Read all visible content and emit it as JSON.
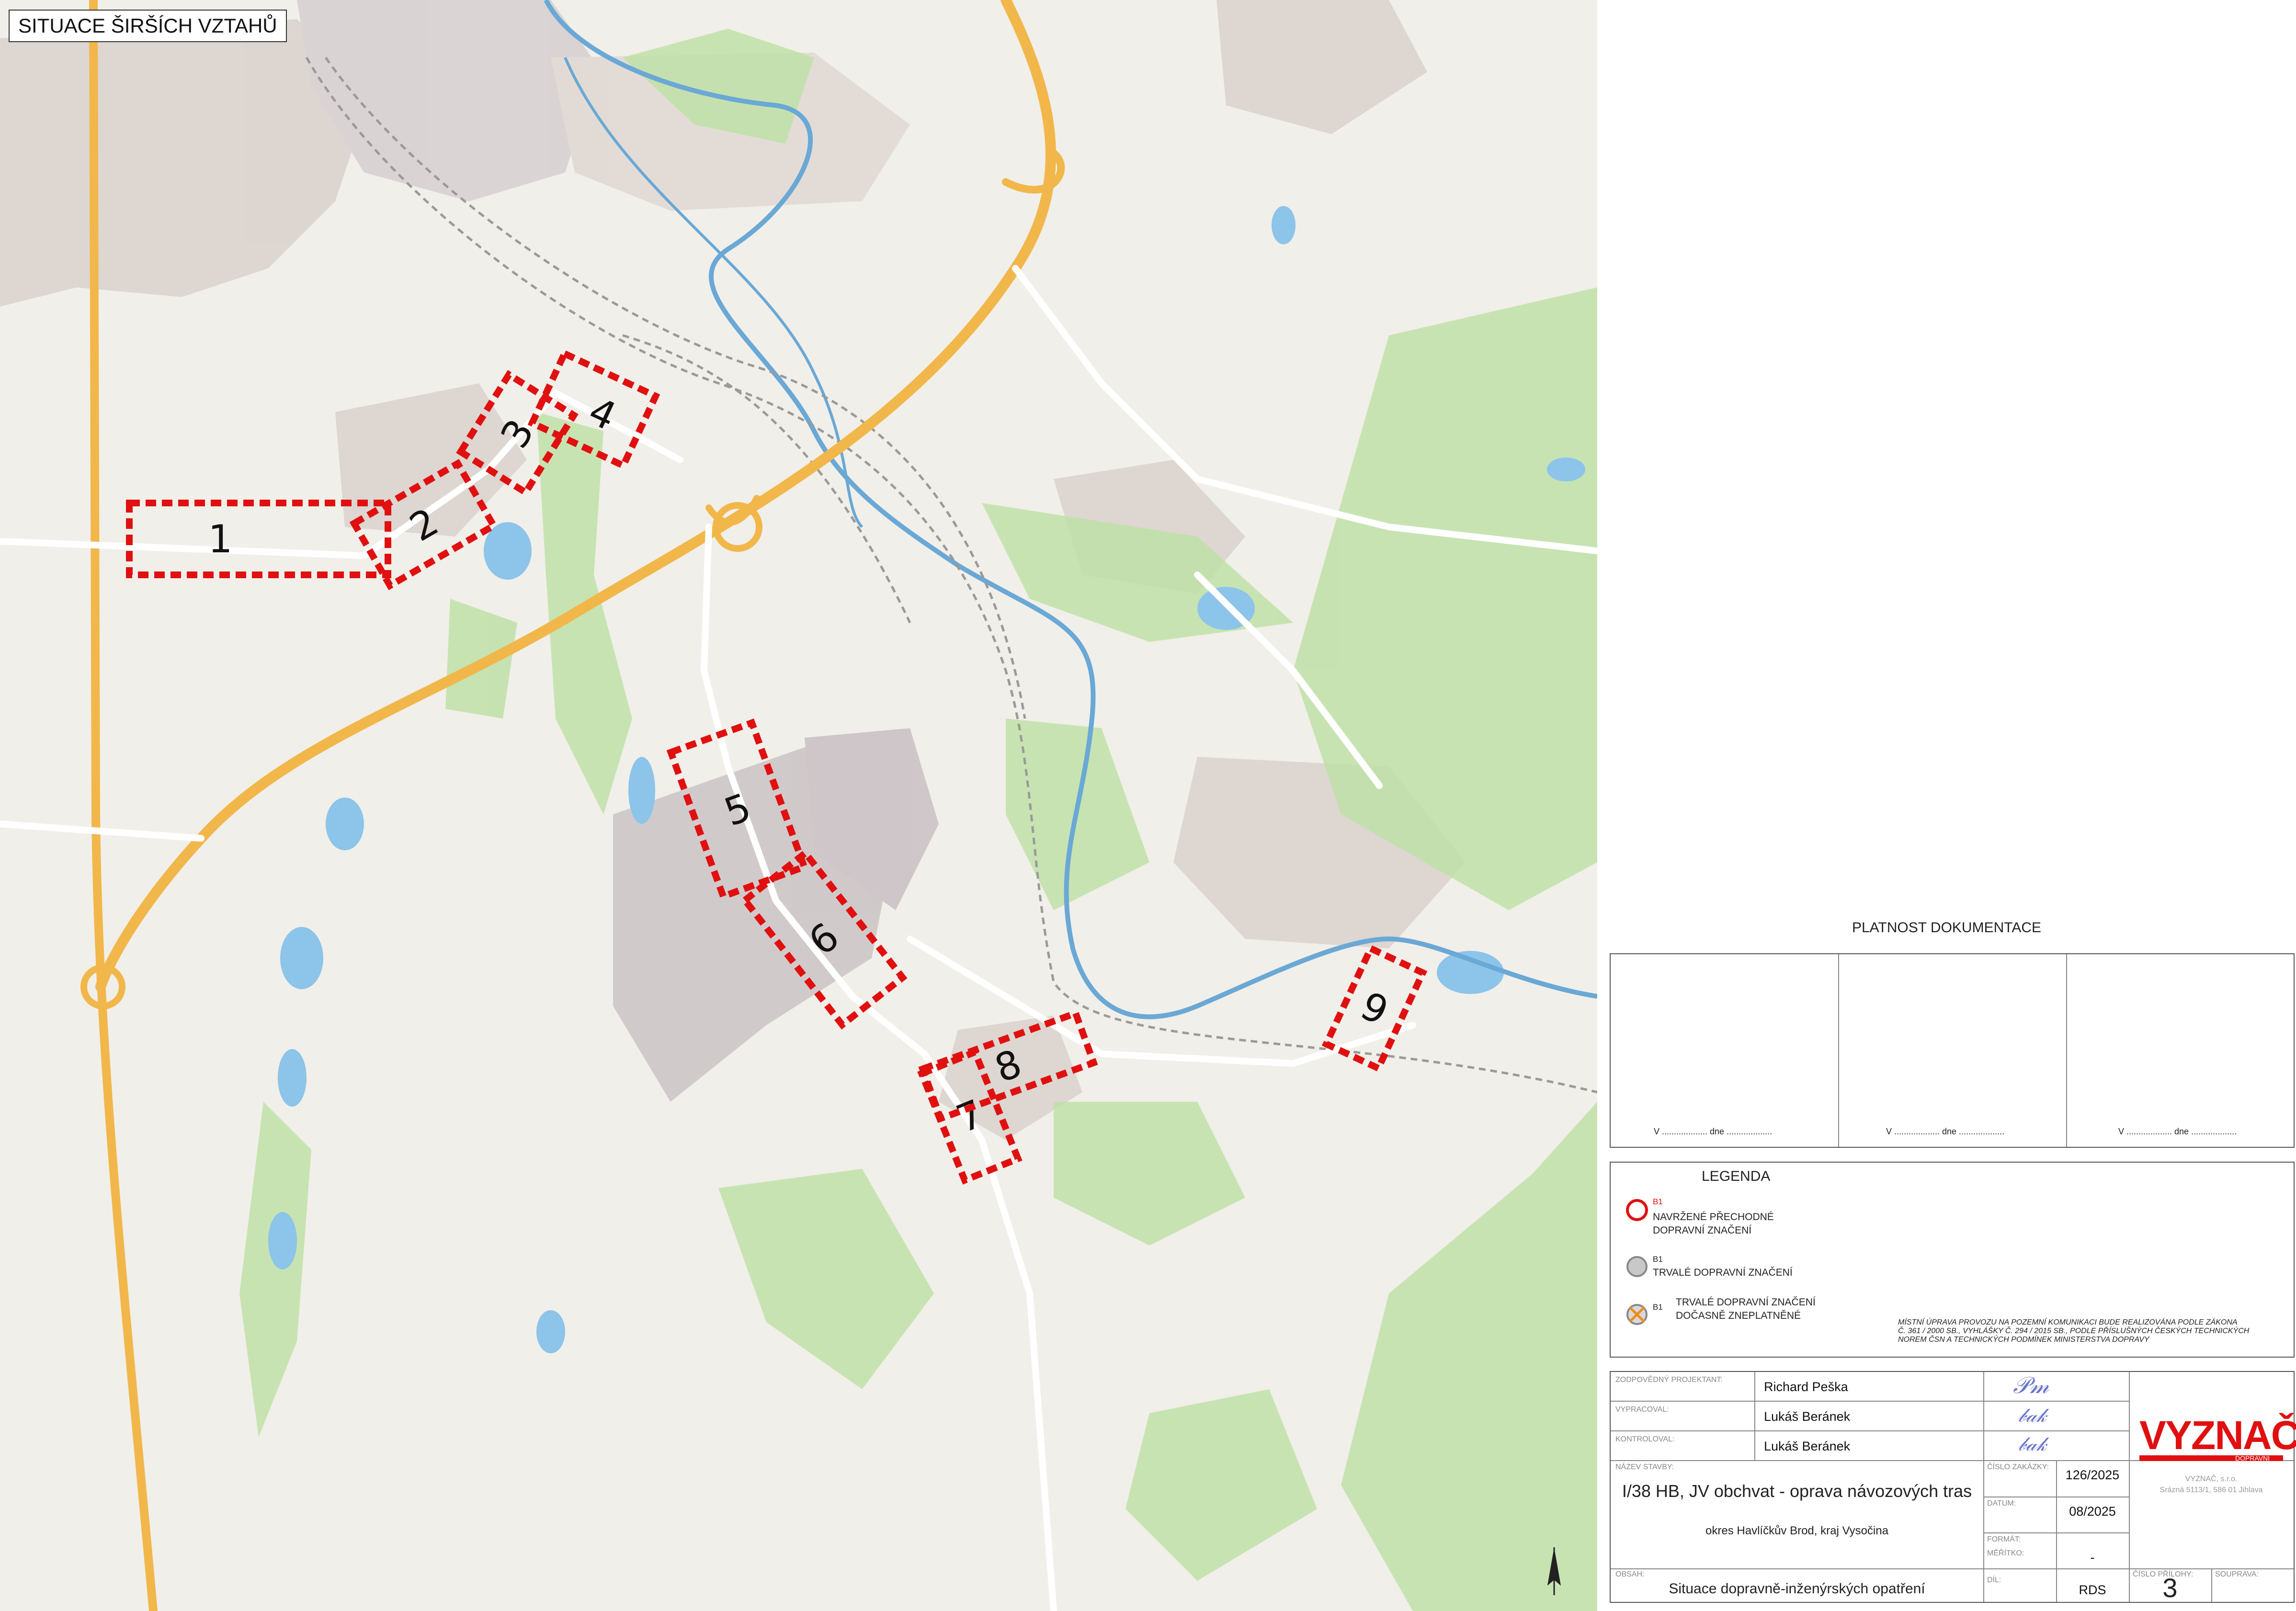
{
  "map": {
    "title": "SITUACE ŠIRŠÍCH VZTAHŮ",
    "areas": [
      {
        "id": "1",
        "label": "1"
      },
      {
        "id": "2",
        "label": "2"
      },
      {
        "id": "3",
        "label": "3"
      },
      {
        "id": "4",
        "label": "4"
      },
      {
        "id": "5",
        "label": "5"
      },
      {
        "id": "6",
        "label": "6"
      },
      {
        "id": "7",
        "label": "7"
      },
      {
        "id": "8",
        "label": "8"
      },
      {
        "id": "9",
        "label": "9"
      }
    ],
    "colors": {
      "area_outline": "#e01010",
      "road_major": "#f2b74a",
      "river": "#6aa8d6",
      "forest": "#bfe0a8",
      "urban": "#d9d1cc",
      "background": "#f1efe9"
    }
  },
  "panel": {
    "validity": {
      "title": "PLATNOST DOKUMENTACE",
      "cells": [
        "V ................... dne ...................",
        "V ................... dne ...................",
        "V ................... dne ..................."
      ]
    },
    "legend": {
      "title": "LEGENDA",
      "items": [
        {
          "code": "B1",
          "text1": "NAVRŽENÉ PŘECHODNÉ",
          "text2": "DOPRAVNÍ ZNAČENÍ",
          "icon": "red-ring-icon"
        },
        {
          "code": "B1",
          "text1": "TRVALÉ DOPRAVNÍ ZNAČENÍ",
          "text2": "",
          "icon": "grey-circle-icon"
        },
        {
          "code": "B1",
          "text1": "TRVALÉ DOPRAVNÍ ZNAČENÍ",
          "text2": "DOČASNĚ ZNEPLATNĚNÉ",
          "icon": "crossed-circle-icon"
        }
      ],
      "note": [
        "MÍSTNÍ ÚPRAVA PROVOZU NA POZEMNÍ KOMUNIKACI BUDE REALIZOVÁNA PODLE ZÁKONA",
        "Č. 361 / 2000 SB., VYHLÁŠKY Č. 294 / 2015 SB., PODLE PŘÍSLUŠNÝCH ČESKÝCH TECHNICKÝCH",
        "NOREM ČSN A TECHNICKÝCH PODMÍNEK MINISTERSTVA DOPRAVY"
      ]
    },
    "title_block": {
      "designer_label": "ZODPOVĚDNÝ PROJEKTANT:",
      "designer": "Richard Peška",
      "drawn_label": "VYPRACOVAL:",
      "drawn": "Lukáš Beránek",
      "checked_label": "KONTROLOVAL:",
      "checked": "Lukáš Beránek",
      "project_label": "NÁZEV STAVBY:",
      "project": "I/38 HB, JV obchvat - oprava návozových tras",
      "location": "okres Havlíčkův Brod, kraj Vysočina",
      "content_label": "OBSAH:",
      "content": "Situace dopravně-inženýrských opatření",
      "order_label": "ČÍSLO ZAKÁZKY:",
      "order": "126/2025",
      "date_label": "DATUM:",
      "date": "08/2025",
      "format_label": "FORMÁT:",
      "format": "",
      "scale_label": "MĚŘÍTKO:",
      "scale": "-",
      "stage_label": "DÍL:",
      "stage": "RDS",
      "sheet_label": "ČÍSLO PŘÍLOHY:",
      "sheet": "3",
      "revision_label": "SOUPRAVA:",
      "company_logo": "VYZNAČ",
      "company_sub": "DOPRAVNÍ ZNAČENÍ",
      "company_line1": "VYZNAČ, s.r.o.",
      "company_line2": "Srázná 5113/1, 586 01 Jihlava"
    }
  }
}
